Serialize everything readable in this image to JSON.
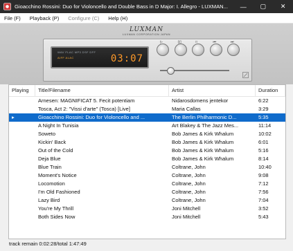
{
  "window": {
    "title": "Gioacchino Rossini: Duo for Violoncello and Double Bass in D Major: I. Allegro - LUXMAN...",
    "controls": {
      "minimize": "—",
      "maximize": "▢",
      "close": "✕"
    }
  },
  "menu": {
    "file": "File (F)",
    "playback": "Playback (P)",
    "configure": "Configure (C)",
    "help": "Help (H)"
  },
  "player": {
    "brand": "LUXMAN",
    "brand_sub": "LUXMAN CORPORATION  JAPAN",
    "formats_line1": "WAV FLAC MP3 DSF DFF",
    "formats_line2": "AIFF ALAC",
    "time": "03:07",
    "volume_level": 0.1,
    "buttons": [
      {
        "name": "play",
        "glyph": "▷"
      },
      {
        "name": "pause",
        "glyph": "▯▯"
      },
      {
        "name": "stop",
        "glyph": "□"
      },
      {
        "name": "prev",
        "glyph": "⏮"
      },
      {
        "name": "next",
        "glyph": "⏭"
      }
    ]
  },
  "playlist": {
    "columns": [
      "Playing",
      "Title/Filename",
      "Artist",
      "Duration"
    ],
    "rows": [
      {
        "playing": "",
        "title": "Arnesen: MAGNIFICAT 5. Fecit potentiam",
        "artist": "Nidarosdomens jentekor",
        "duration": "6:22"
      },
      {
        "playing": "",
        "title": "Tosca, Act 2: \"Vissi d'arte\" (Tosca) [Live]",
        "artist": "Maria Callas",
        "duration": "3:29"
      },
      {
        "playing": "▸",
        "title": "Gioacchino Rossini: Duo for Violoncello and ...",
        "artist": "The Berlin Philharmonic D...",
        "duration": "5:35"
      },
      {
        "playing": "",
        "title": "A Night In Tunisia",
        "artist": "Art Blakey & The Jazz Mes...",
        "duration": "11:14"
      },
      {
        "playing": "",
        "title": "Soweto",
        "artist": "Bob James & Kirk Whalum",
        "duration": "10:02"
      },
      {
        "playing": "",
        "title": "Kickin' Back",
        "artist": "Bob James & Kirk Whalum",
        "duration": "6:01"
      },
      {
        "playing": "",
        "title": "Out of the Cold",
        "artist": "Bob James & Kirk Whalum",
        "duration": "5:16"
      },
      {
        "playing": "",
        "title": "Deja Blue",
        "artist": "Bob James & Kirk Whalum",
        "duration": "8:14"
      },
      {
        "playing": "",
        "title": "Blue Train",
        "artist": "Coltrane, John",
        "duration": "10:40"
      },
      {
        "playing": "",
        "title": "Moment's Notice",
        "artist": "Coltrane, John",
        "duration": "9:08"
      },
      {
        "playing": "",
        "title": "Locomotion",
        "artist": "Coltrane, John",
        "duration": "7:12"
      },
      {
        "playing": "",
        "title": "I'm Old Fashioned",
        "artist": "Coltrane, John",
        "duration": "7:56"
      },
      {
        "playing": "",
        "title": "Lazy Bird",
        "artist": "Coltrane, John",
        "duration": "7:04"
      },
      {
        "playing": "",
        "title": "You're My Thrill",
        "artist": "Joni Mitchell",
        "duration": "3:52"
      },
      {
        "playing": "",
        "title": "Both Sides Now",
        "artist": "Joni Mitchell",
        "duration": "5:43"
      }
    ]
  },
  "status": "track remain 0:02:28/total 1:47:49",
  "colors": {
    "selection": "#0f6bcb",
    "display_digits": "#ff9a2a",
    "titlebar": "#2b2b2b"
  }
}
